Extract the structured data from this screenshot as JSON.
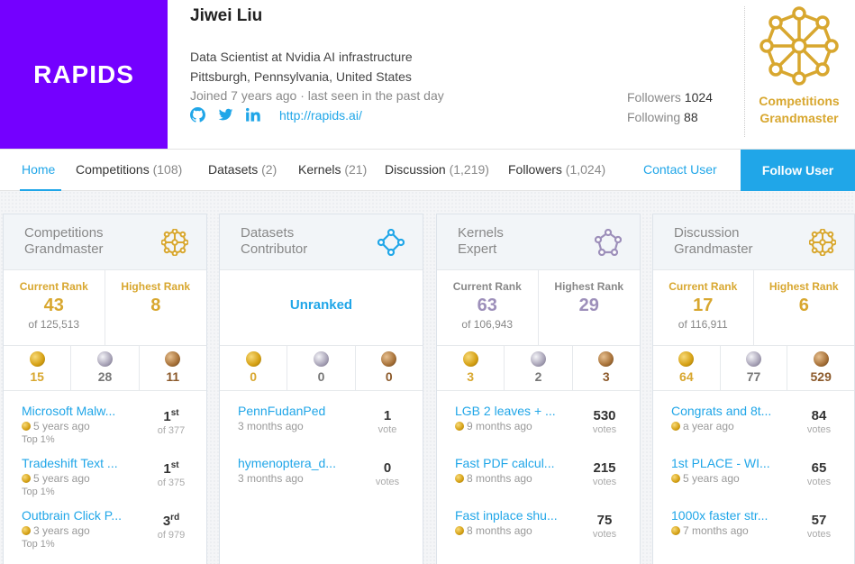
{
  "logo": {
    "text": "RAPIDS"
  },
  "profile": {
    "name": "Jiwei Liu",
    "title": "Data Scientist at Nvidia AI infrastructure",
    "location": "Pittsburgh, Pennsylvania, United States",
    "joined": "Joined 7 years ago · last seen in the past day",
    "website": "http://rapids.ai/",
    "followers_label": "Followers",
    "followers_value": "1024",
    "following_label": "Following",
    "following_value": "88",
    "tier_line1": "Competitions",
    "tier_line2": "Grandmaster"
  },
  "colors": {
    "accent": "#20a6e8",
    "brand": "#7400ff",
    "gold": "#d8a72f",
    "kernels_tier": "#9d8fba"
  },
  "nav": {
    "home": "Home",
    "tabs": [
      {
        "label": "Competitions",
        "count": "(108)"
      },
      {
        "label": "Datasets",
        "count": "(2)"
      },
      {
        "label": "Kernels",
        "count": "(21)"
      },
      {
        "label": "Discussion",
        "count": "(1,219)"
      },
      {
        "label": "Followers",
        "count": "(1,024)"
      }
    ],
    "contact": "Contact User",
    "follow": "Follow User"
  },
  "cards": [
    {
      "title1": "Competitions",
      "title2": "Grandmaster",
      "current_label": "Current Rank",
      "current": "43",
      "current_of": "of 125,513",
      "highest_label": "Highest Rank",
      "highest": "8",
      "medals": [
        "15",
        "28",
        "11"
      ],
      "items": [
        {
          "name": "Microsoft Malw...",
          "time": "5 years ago",
          "extra": "Top 1%",
          "rank": "1",
          "suffix": "st",
          "of": "of 377"
        },
        {
          "name": "Tradeshift Text ...",
          "time": "5 years ago",
          "extra": "Top 1%",
          "rank": "1",
          "suffix": "st",
          "of": "of 375"
        },
        {
          "name": "Outbrain Click P...",
          "time": "3 years ago",
          "extra": "Top 1%",
          "rank": "3",
          "suffix": "rd",
          "of": "of 979"
        }
      ]
    },
    {
      "title1": "Datasets",
      "title2": "Contributor",
      "unranked": "Unranked",
      "medals": [
        "0",
        "0",
        "0"
      ],
      "items": [
        {
          "name": "PennFudanPed",
          "time": "3 months ago",
          "value": "1",
          "unit": "vote"
        },
        {
          "name": "hymenoptera_d...",
          "time": "3 months ago",
          "value": "0",
          "unit": "votes"
        }
      ]
    },
    {
      "title1": "Kernels",
      "title2": "Expert",
      "current_label": "Current Rank",
      "current": "63",
      "current_of": "of 106,943",
      "highest_label": "Highest Rank",
      "highest": "29",
      "medals": [
        "3",
        "2",
        "3"
      ],
      "items": [
        {
          "name": "LGB 2 leaves + ...",
          "time": "9 months ago",
          "value": "530",
          "unit": "votes"
        },
        {
          "name": "Fast PDF calcul...",
          "time": "8 months ago",
          "value": "215",
          "unit": "votes"
        },
        {
          "name": "Fast inplace shu...",
          "time": "8 months ago",
          "value": "75",
          "unit": "votes"
        }
      ]
    },
    {
      "title1": "Discussion",
      "title2": "Grandmaster",
      "current_label": "Current Rank",
      "current": "17",
      "current_of": "of 116,911",
      "highest_label": "Highest Rank",
      "highest": "6",
      "medals": [
        "64",
        "77",
        "529"
      ],
      "items": [
        {
          "name": "Congrats and 8t...",
          "time": "a year ago",
          "value": "84",
          "unit": "votes"
        },
        {
          "name": "1st PLACE - WI...",
          "time": "5 years ago",
          "value": "65",
          "unit": "votes"
        },
        {
          "name": "1000x faster str...",
          "time": "7 months ago",
          "value": "57",
          "unit": "votes"
        }
      ]
    }
  ]
}
